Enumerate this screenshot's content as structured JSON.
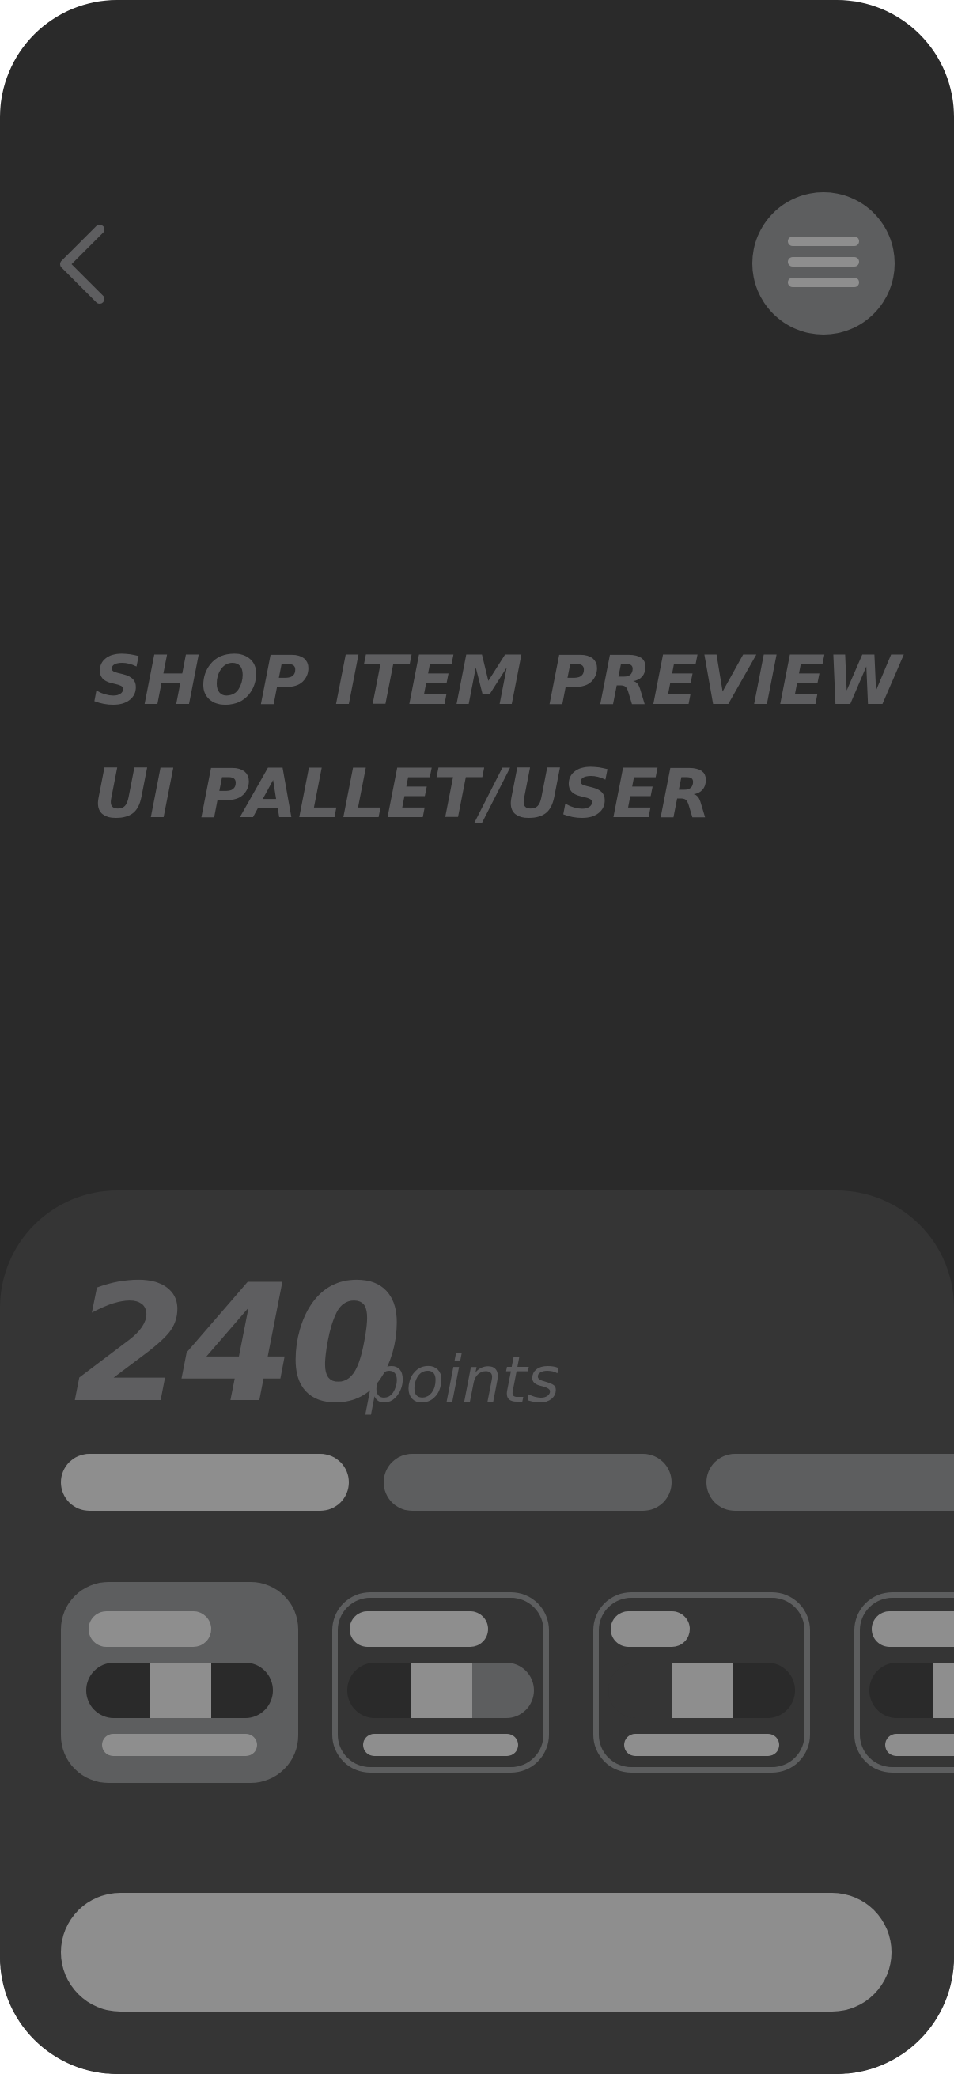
{
  "header": {
    "back_icon": "chevron-left-icon",
    "menu_icon": "hamburger-icon"
  },
  "title": {
    "line1": "SHOP ITEM PREVIEW",
    "line2": "UI PALLET/USER"
  },
  "points": {
    "value": "240",
    "label": "points"
  },
  "colors": {
    "background": "#2a2a2a",
    "panel": "#353535",
    "muted": "#5e5e60",
    "light": "#8e8e8e",
    "dark": "#2a2a2a"
  },
  "tabs": [
    {
      "state": "selected"
    },
    {
      "state": "unselected"
    },
    {
      "state": "unselected"
    }
  ],
  "cards": [
    {
      "state": "selected"
    },
    {
      "state": "unselected"
    },
    {
      "state": "unselected"
    },
    {
      "state": "unselected"
    }
  ]
}
